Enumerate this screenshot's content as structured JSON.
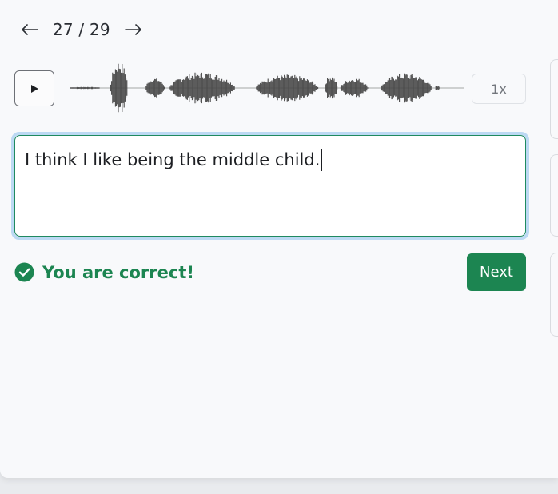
{
  "nav": {
    "counter": "27 / 29",
    "prev_icon": "arrow-left-icon",
    "next_icon": "arrow-right-icon"
  },
  "player": {
    "play_icon": "play-icon",
    "speed_label": "1x",
    "waveform_color": "#4a4a4a"
  },
  "answer": {
    "text": "I think I like being the middle child."
  },
  "feedback": {
    "message": "You are correct!",
    "icon": "check-circle-icon",
    "color": "#1c8551"
  },
  "actions": {
    "next_label": "Next"
  }
}
